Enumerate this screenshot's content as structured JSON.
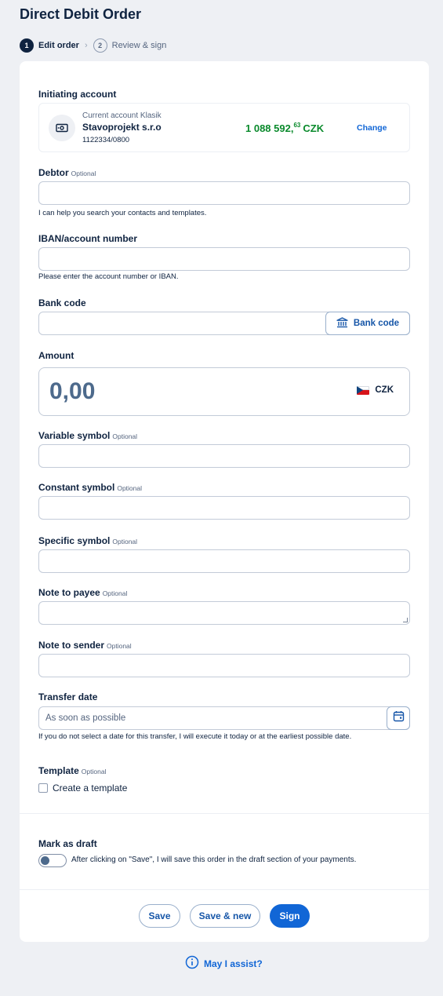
{
  "page": {
    "title": "Direct Debit Order"
  },
  "stepper": {
    "steps": [
      {
        "number": "1",
        "label": "Edit order",
        "active": true
      },
      {
        "number": "2",
        "label": "Review & sign",
        "active": false
      }
    ],
    "separator": "›"
  },
  "initiating_account": {
    "label": "Initiating account",
    "type": "Current account Klasik",
    "name": "Stavoprojekt s.r.o",
    "number": "1122334/0800",
    "balance_main": "1 088 592,",
    "balance_fraction": "63",
    "balance_currency": "CZK",
    "change_label": "Change",
    "icon": "banknote-icon"
  },
  "optional_label": "Optional",
  "debtor": {
    "label": "Debtor",
    "value": "",
    "hint": "I can help you search your contacts and templates."
  },
  "iban": {
    "label": "IBAN/account number",
    "value": "",
    "hint": "Please enter the account number or IBAN."
  },
  "bank_code": {
    "label": "Bank code",
    "value": "",
    "button_label": "Bank code",
    "button_icon": "bank-icon"
  },
  "amount": {
    "label": "Amount",
    "value": "0,00",
    "currency": "CZK",
    "flag": "czech-flag-icon"
  },
  "variable_symbol": {
    "label": "Variable symbol",
    "value": ""
  },
  "constant_symbol": {
    "label": "Constant symbol",
    "value": ""
  },
  "specific_symbol": {
    "label": "Specific symbol",
    "value": ""
  },
  "note_to_payee": {
    "label": "Note to payee",
    "value": ""
  },
  "note_to_sender": {
    "label": "Note to sender",
    "value": ""
  },
  "transfer_date": {
    "label": "Transfer date",
    "placeholder": "As soon as possible",
    "hint": "If you do not select a date for this transfer, I will execute it today or at the earliest possible date.",
    "icon": "calendar-icon"
  },
  "template": {
    "label": "Template",
    "checkbox_label": "Create a template",
    "checked": false
  },
  "draft": {
    "label": "Mark as draft",
    "description": "After clicking on \"Save\", I will save this order in the draft section of your payments.",
    "enabled": false
  },
  "actions": {
    "save": "Save",
    "save_new": "Save & new",
    "sign": "Sign"
  },
  "assist": {
    "label": "May I assist?",
    "icon": "info-icon"
  },
  "colors": {
    "primary": "#1166d6",
    "navy": "#0f2340",
    "balance_green": "#0a8a2c",
    "background": "#eef0f4"
  }
}
